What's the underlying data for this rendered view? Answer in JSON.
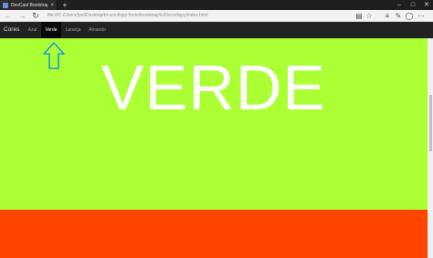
{
  "browser": {
    "tab_title": "DevCast Bootstrap - Scr",
    "tab_close": "×",
    "new_tab": "+",
    "url": "file:///C:/Users/joel/Desktop/bt-scrollspy-fonte/bootstrap%20scrollspy/index.html",
    "icons": [
      "back-icon",
      "forward-icon",
      "refresh-icon",
      "reading-view-icon",
      "favorite-star-icon",
      "hub-icon",
      "web-note-icon",
      "share-icon",
      "more-icon"
    ],
    "window_controls": {
      "minimize": "–",
      "maximize": "□",
      "close": "✕"
    }
  },
  "navbar": {
    "brand": "Cores",
    "links": [
      {
        "label": "Azul",
        "active": false
      },
      {
        "label": "Verde",
        "active": true
      },
      {
        "label": "Laranja",
        "active": false
      },
      {
        "label": "Amarelo",
        "active": false
      }
    ]
  },
  "sections": {
    "green": {
      "title": "VERDE",
      "color": "#abff33"
    },
    "orange": {
      "color": "#ff4500"
    }
  },
  "annotation": {
    "color": "#1e9bd7",
    "icon": "up-arrow-icon"
  },
  "colors": {
    "navbar": "#222222",
    "navbar_active": "#080808"
  }
}
